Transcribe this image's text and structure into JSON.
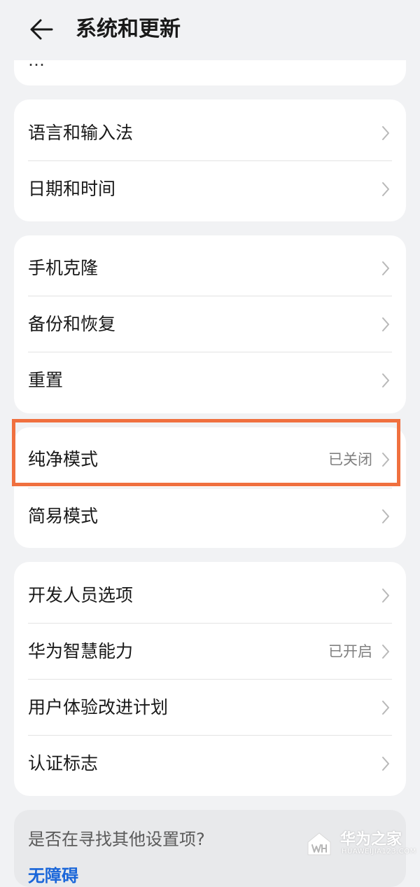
{
  "header": {
    "title": "系统和更新"
  },
  "partial_item": {
    "label": "…"
  },
  "groups": [
    {
      "items": [
        {
          "label": "语言和输入法",
          "status": ""
        },
        {
          "label": "日期和时间",
          "status": ""
        }
      ]
    },
    {
      "items": [
        {
          "label": "手机克隆",
          "status": ""
        },
        {
          "label": "备份和恢复",
          "status": ""
        },
        {
          "label": "重置",
          "status": ""
        }
      ]
    },
    {
      "items": [
        {
          "label": "纯净模式",
          "status": "已关闭"
        },
        {
          "label": "简易模式",
          "status": ""
        }
      ]
    },
    {
      "items": [
        {
          "label": "开发人员选项",
          "status": ""
        },
        {
          "label": "华为智慧能力",
          "status": "已开启"
        },
        {
          "label": "用户体验改进计划",
          "status": ""
        },
        {
          "label": "认证标志",
          "status": ""
        }
      ]
    }
  ],
  "search_section": {
    "title": "是否在寻找其他设置项?",
    "link": "无障碍"
  },
  "watermark": {
    "title": "华为之家",
    "subtitle": "HUAWEIJIA123.COM"
  },
  "colors": {
    "background": "#f1f2f4",
    "card": "#ffffff",
    "highlight": "#f0703f",
    "link": "#1a66d9"
  }
}
